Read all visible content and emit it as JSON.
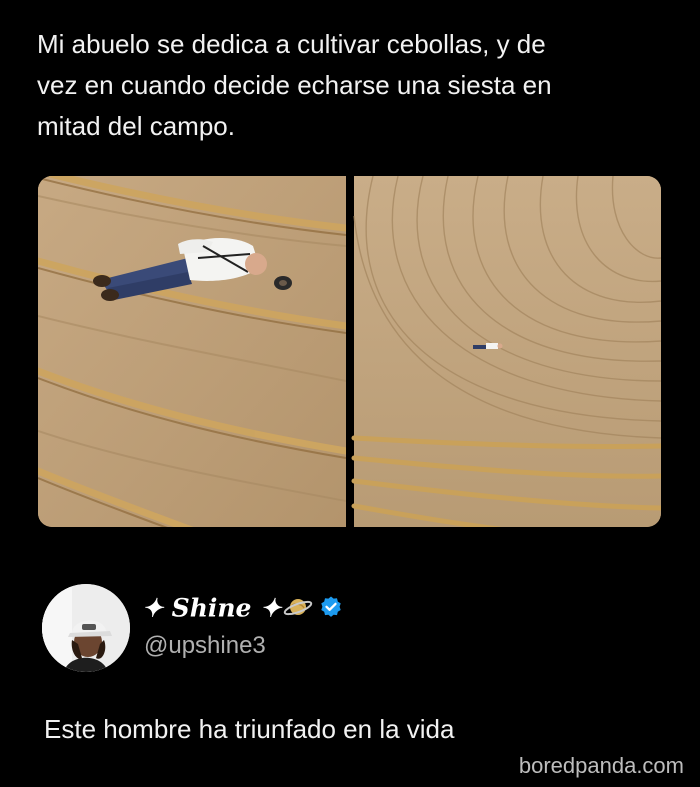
{
  "quoted_post": {
    "text_lines": [
      "Mi abuelo se dedica a cultivar cebollas, y de",
      "vez en cuando decide echarse una siesta en",
      "mitad del campo."
    ],
    "images": [
      {
        "subject": "elderly man lying down among onion field rows"
      },
      {
        "subject": "wide aerial view of curved plowed field with tiny figure lying in it"
      }
    ]
  },
  "author": {
    "display_name": "✦ Shine ✦",
    "name_emoji_icon": "ringed-planet-icon",
    "verified_icon": "verified-badge-icon",
    "handle": "@upshine3"
  },
  "post": {
    "text": "Este hombre ha triunfado en la vida"
  },
  "watermark": "boredpanda.com",
  "colors": {
    "background": "#000000",
    "text": "#f2f2f2",
    "secondary_text": "#b0b0b0",
    "verified": "#1d9bf0",
    "field": "#b89a72"
  }
}
